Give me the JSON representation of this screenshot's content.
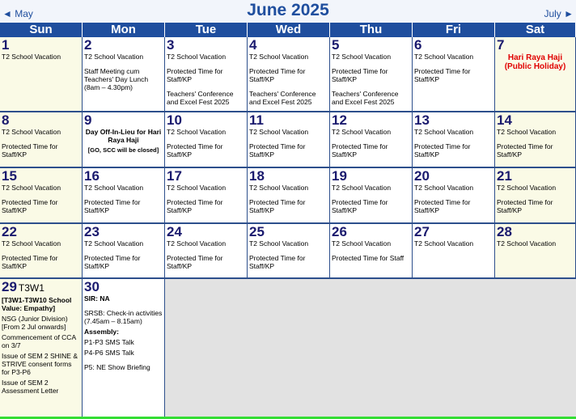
{
  "header": {
    "title": "June 2025",
    "prev": "◄ May",
    "next": "July ►"
  },
  "days_of_week": [
    "Sun",
    "Mon",
    "Tue",
    "Wed",
    "Thu",
    "Fri",
    "Sat"
  ],
  "weeks": [
    [
      {
        "day": "1",
        "weekend": true,
        "events": [
          {
            "text": "T2 School Vacation"
          }
        ]
      },
      {
        "day": "2",
        "events": [
          {
            "text": "T2 School Vacation"
          },
          {
            "text": "Staff Meeting cum Teachers' Day Lunch (8am – 4.30pm)"
          }
        ]
      },
      {
        "day": "3",
        "events": [
          {
            "text": "T2 School Vacation"
          },
          {
            "text": "Protected Time for Staff/KP"
          },
          {
            "text": "Teachers' Conference and Excel Fest 2025"
          }
        ]
      },
      {
        "day": "4",
        "events": [
          {
            "text": "T2 School Vacation"
          },
          {
            "text": "Protected Time for Staff/KP"
          },
          {
            "text": "Teachers' Conference and Excel Fest 2025"
          }
        ]
      },
      {
        "day": "5",
        "events": [
          {
            "text": "T2 School Vacation"
          },
          {
            "text": "Protected Time for Staff/KP"
          },
          {
            "text": "Teachers' Conference and Excel Fest 2025"
          }
        ]
      },
      {
        "day": "6",
        "events": [
          {
            "text": "T2 School Vacation"
          },
          {
            "text": "Protected Time for Staff/KP"
          }
        ]
      },
      {
        "day": "7",
        "weekend": true,
        "events": [
          {
            "text": "Hari Raya Haji (Public Holiday)",
            "style": "red"
          }
        ]
      }
    ],
    [
      {
        "day": "8",
        "weekend": true,
        "events": [
          {
            "text": "T2 School Vacation"
          },
          {
            "text": "Protected Time for Staff/KP"
          }
        ]
      },
      {
        "day": "9",
        "events": [
          {
            "text": "Day Off-In-Lieu for Hari Raya Haji",
            "style": "center tight"
          },
          {
            "text": "[GO, SCC will be closed]",
            "style": "center small"
          }
        ]
      },
      {
        "day": "10",
        "events": [
          {
            "text": "T2 School Vacation"
          },
          {
            "text": "Protected Time for Staff/KP"
          }
        ]
      },
      {
        "day": "11",
        "events": [
          {
            "text": "T2 School Vacation"
          },
          {
            "text": "Protected Time for Staff/KP"
          }
        ]
      },
      {
        "day": "12",
        "events": [
          {
            "text": "T2 School Vacation"
          },
          {
            "text": "Protected Time for Staff/KP"
          }
        ]
      },
      {
        "day": "13",
        "events": [
          {
            "text": "T2 School Vacation"
          },
          {
            "text": "Protected Time for Staff/KP"
          }
        ]
      },
      {
        "day": "14",
        "weekend": true,
        "events": [
          {
            "text": "T2 School Vacation"
          },
          {
            "text": "Protected Time for Staff/KP"
          }
        ]
      }
    ],
    [
      {
        "day": "15",
        "weekend": true,
        "events": [
          {
            "text": "T2 School Vacation"
          },
          {
            "text": "Protected Time for Staff/KP"
          }
        ]
      },
      {
        "day": "16",
        "events": [
          {
            "text": "T2 School Vacation"
          },
          {
            "text": "Protected Time for Staff/KP"
          }
        ]
      },
      {
        "day": "17",
        "events": [
          {
            "text": "T2 School Vacation"
          },
          {
            "text": "Protected Time for Staff/KP"
          }
        ]
      },
      {
        "day": "18",
        "events": [
          {
            "text": "T2 School Vacation"
          },
          {
            "text": "Protected Time for Staff/KP"
          }
        ]
      },
      {
        "day": "19",
        "events": [
          {
            "text": "T2 School Vacation"
          },
          {
            "text": "Protected Time for Staff/KP"
          }
        ]
      },
      {
        "day": "20",
        "events": [
          {
            "text": "T2 School Vacation"
          },
          {
            "text": "Protected Time for Staff/KP"
          }
        ]
      },
      {
        "day": "21",
        "weekend": true,
        "events": [
          {
            "text": "T2 School Vacation"
          },
          {
            "text": "Protected Time for Staff/KP"
          }
        ]
      }
    ],
    [
      {
        "day": "22",
        "weekend": true,
        "events": [
          {
            "text": "T2 School Vacation"
          },
          {
            "text": "Protected Time for Staff/KP"
          }
        ]
      },
      {
        "day": "23",
        "events": [
          {
            "text": "T2 School Vacation"
          },
          {
            "text": "Protected Time for Staff/KP"
          }
        ]
      },
      {
        "day": "24",
        "events": [
          {
            "text": "T2 School Vacation"
          },
          {
            "text": "Protected Time for Staff/KP"
          }
        ]
      },
      {
        "day": "25",
        "events": [
          {
            "text": "T2 School Vacation"
          },
          {
            "text": "Protected Time for Staff/KP"
          }
        ]
      },
      {
        "day": "26",
        "events": [
          {
            "text": "T2 School Vacation"
          },
          {
            "text": "Protected Time for Staff"
          }
        ]
      },
      {
        "day": "27",
        "events": [
          {
            "text": "T2 School Vacation"
          }
        ]
      },
      {
        "day": "28",
        "weekend": true,
        "events": [
          {
            "text": "T2 School Vacation"
          }
        ]
      }
    ],
    [
      {
        "day": "29",
        "tag": "T3W1",
        "weekend": true,
        "events": [
          {
            "text": "[T3W1-T3W10 School Value: Empathy]",
            "style": "bold tight"
          },
          {
            "text": "NSG (Junior Division) [From 2 Jul onwards]",
            "style": "tight"
          },
          {
            "text": "Commencement of CCA on 3/7",
            "style": "tight"
          },
          {
            "text": "Issue of SEM 2 SHINE & STRIVE consent forms for P3-P6",
            "style": "tight"
          },
          {
            "text": "Issue of SEM 2 Assessment Letter",
            "style": "tight"
          }
        ]
      },
      {
        "day": "30",
        "events": [
          {
            "text": "SIR: NA",
            "style": "bold"
          },
          {
            "text": "SRSB: Check-in activities (7.45am – 8.15am)",
            "style": "tight"
          },
          {
            "text": "Assembly:",
            "style": "bold tight"
          },
          {
            "text": "P1-P3 SMS Talk",
            "style": "tight"
          },
          {
            "text": "P4-P6 SMS Talk"
          },
          {
            "text": "P5: NE Show Briefing"
          }
        ]
      }
    ]
  ]
}
